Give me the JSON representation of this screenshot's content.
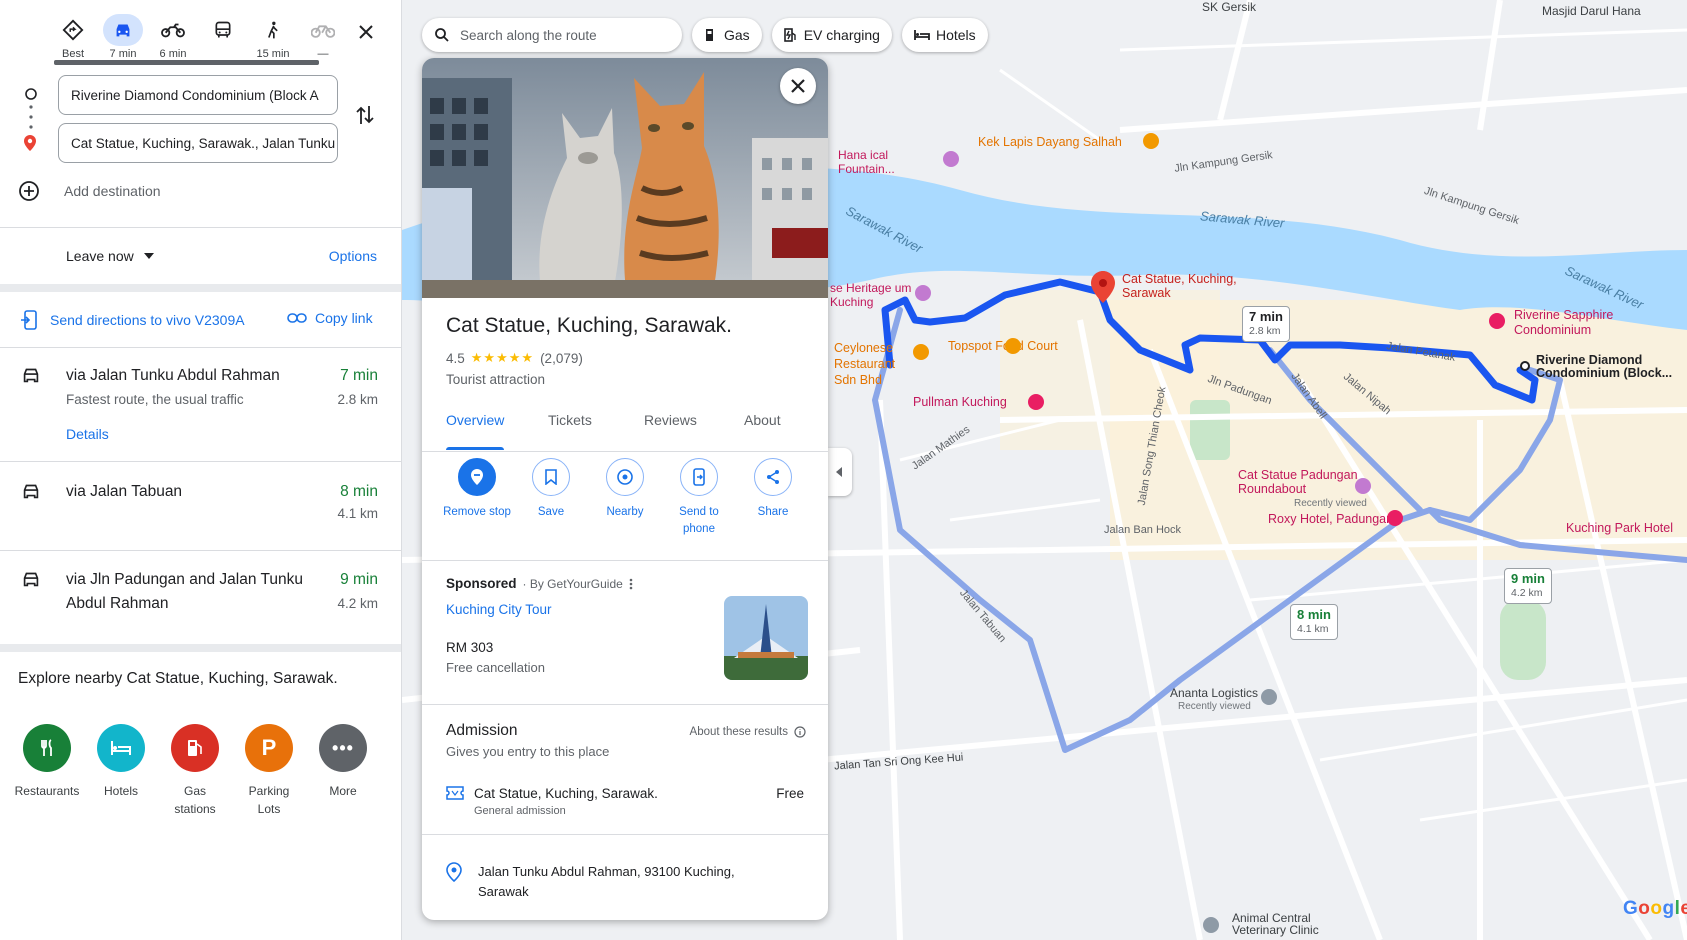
{
  "modes": [
    {
      "name": "best",
      "label": "Best",
      "icon": "diamond-route-icon",
      "active": false
    },
    {
      "name": "driving",
      "label": "7 min",
      "icon": "car-icon",
      "active": true
    },
    {
      "name": "motorcycle",
      "label": "6 min",
      "icon": "motorcycle-icon",
      "active": false
    },
    {
      "name": "transit",
      "label": "",
      "icon": "bus-icon",
      "active": false
    },
    {
      "name": "walking",
      "label": "15 min",
      "icon": "walk-icon",
      "active": false
    },
    {
      "name": "cycling",
      "label": "—",
      "icon": "bicycle-icon",
      "active": false
    }
  ],
  "waypoints": {
    "origin": "Riverine Diamond Condominium (Block A",
    "destination": "Cat Statue, Kuching, Sarawak., Jalan Tunku",
    "add_destination": "Add destination"
  },
  "depart": {
    "leave_now": "Leave now",
    "options": "Options"
  },
  "share": {
    "send_directions": "Send directions to vivo V2309A",
    "copy_link": "Copy link"
  },
  "routes": [
    {
      "via": "via Jalan Tunku Abdul Rahman",
      "time": "7 min",
      "distance": "2.8 km",
      "note": "Fastest route, the usual traffic",
      "details": "Details"
    },
    {
      "via": "via Jalan Tabuan",
      "time": "8 min",
      "distance": "4.1 km"
    },
    {
      "via": "via Jln Padungan and Jalan Tunku Abdul Rahman",
      "time": "9 min",
      "distance": "4.2 km"
    }
  ],
  "explore": {
    "title": "Explore nearby Cat Statue, Kuching, Sarawak.",
    "categories": [
      {
        "label": "Restaurants",
        "color": "#188038",
        "icon": "fork-knife-icon"
      },
      {
        "label": "Hotels",
        "color": "#12b5cb",
        "icon": "bed-icon"
      },
      {
        "label": "Gas stations",
        "color": "#d93025",
        "icon": "gas-pump-icon"
      },
      {
        "label": "Parking Lots",
        "color": "#e8710a",
        "icon": "parking-icon"
      },
      {
        "label": "More",
        "color": "#5f6368",
        "icon": "more-dots-icon"
      }
    ]
  },
  "map_top": {
    "search_placeholder": "Search along the route",
    "chips": [
      "Gas",
      "EV charging",
      "Hotels"
    ]
  },
  "place": {
    "title": "Cat Statue, Kuching, Sarawak.",
    "rating": "4.5",
    "stars": "★★★★★",
    "reviews": "(2,079)",
    "type": "Tourist attraction",
    "tabs": [
      "Overview",
      "Tickets",
      "Reviews",
      "About"
    ],
    "actions": [
      {
        "label": "Remove stop",
        "icon": "remove-stop-icon"
      },
      {
        "label": "Save",
        "icon": "bookmark-icon"
      },
      {
        "label": "Nearby",
        "icon": "nearby-icon"
      },
      {
        "label": "Send to phone",
        "icon": "send-to-phone-icon"
      },
      {
        "label": "Share",
        "icon": "share-icon"
      }
    ],
    "sponsored": "Sponsored",
    "sponsor_by": "· By GetYourGuide",
    "tour_name": "Kuching City Tour",
    "tour_price": "RM 303",
    "tour_note": "Free cancellation",
    "admission_title": "Admission",
    "admission_sub": "Gives you entry to this place",
    "about_results": "About these results",
    "ticket_name": "Cat Statue, Kuching, Sarawak.",
    "ticket_sub": "General admission",
    "ticket_price": "Free",
    "address": "Jalan Tunku Abdul Rahman, 93100 Kuching, Sarawak"
  },
  "map_labels": {
    "sk_gersik": "SK Gersik",
    "masjid": "Masjid Darul Hana",
    "kek_lapis": "Kek Lapis Dayang Salhah",
    "jln_kampung_gersik": "Jln Kampung Gersik",
    "jln_kampung_gersik2": "Jln Kampung Gersik",
    "sarawak_river": "Sarawak River",
    "sarawak_river2": "Sarawak River",
    "sarawak_river3": "Sarawak River",
    "cat_statue_pin": "Cat Statue, Kuching, Sarawak",
    "riverine_sapphire": "Riverine Sapphire Condominium",
    "riverine_diamond": "Riverine Diamond Condominium (Block...",
    "topspot": "Topspot Food Court",
    "ceylonese": "Ceylonese Restaurant Sdn Bhd",
    "pullman": "Pullman Kuching",
    "heritage": "se Heritage um Kuching",
    "hana": "Hana ical Fountain...",
    "cat_statue_padungan": "Cat Statue Padungan Roundabout",
    "recently_viewed": "Recently viewed",
    "roxy": "Roxy Hotel, Padungan",
    "kuching_park": "Kuching Park Hotel",
    "jalan_ban_hock": "Jalan Ban Hock",
    "jalan_mathies": "Jalan Mathies",
    "jalan_tabuan": "Jalan Tabuan",
    "jalan_song_thian_cheok": "Jalan Song Thian Cheok",
    "jln_padungan": "Jln Padungan",
    "jalan_petanak": "Jalan Petanak",
    "jalan_abell": "Jalan Abell",
    "jalan_nipah": "Jalan Nipah",
    "jalan_tan_sri": "Jalan Tan Sri Ong Kee Hui",
    "ananta": "Ananta Logistics",
    "ananta_recent": "Recently viewed",
    "animal_clinic": "Animal Central Veterinary Clinic",
    "google": "Google"
  },
  "route_boxes": [
    {
      "time": "7 min",
      "dist": "2.8 km"
    },
    {
      "time": "8 min",
      "dist": "4.1 km"
    },
    {
      "time": "9 min",
      "dist": "4.2 km"
    }
  ],
  "colors": {
    "route_primary": "#1a56f0",
    "route_alt": "#8aa6e8",
    "water": "#aadaff",
    "accent": "#1a73e8"
  }
}
